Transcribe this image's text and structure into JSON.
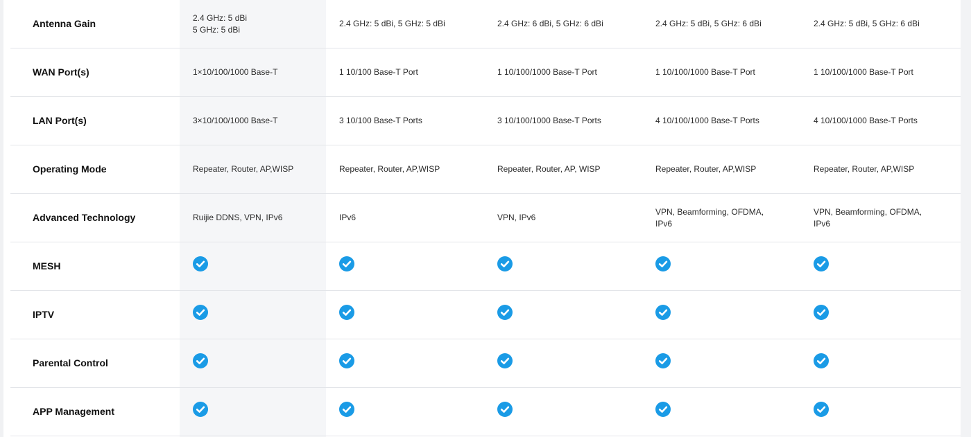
{
  "table": {
    "rows": [
      {
        "label": "Antenna Gain",
        "type": "text",
        "cells": [
          "2.4 GHz: 5 dBi\n5 GHz: 5 dBi",
          "2.4 GHz: 5 dBi, 5 GHz: 5 dBi",
          "2.4 GHz: 6 dBi, 5 GHz: 6 dBi",
          "2.4 GHz: 5 dBi, 5 GHz: 6 dBi",
          "2.4 GHz: 5 dBi, 5 GHz: 6 dBi"
        ]
      },
      {
        "label": "WAN Port(s)",
        "type": "text",
        "cells": [
          "1×10/100/1000 Base-T",
          "1 10/100 Base-T Port",
          "1 10/100/1000 Base-T Port",
          "1 10/100/1000 Base-T Port",
          "1 10/100/1000 Base-T Port"
        ]
      },
      {
        "label": "LAN Port(s)",
        "type": "text",
        "cells": [
          "3×10/100/1000 Base-T",
          "3 10/100 Base-T Ports",
          "3 10/100/1000 Base-T Ports",
          "4 10/100/1000 Base-T Ports",
          "4 10/100/1000 Base-T Ports"
        ]
      },
      {
        "label": "Operating Mode",
        "type": "text",
        "cells": [
          "Repeater, Router, AP,WISP",
          "Repeater, Router, AP,WISP",
          "Repeater, Router, AP, WISP",
          "Repeater, Router, AP,WISP",
          "Repeater, Router, AP,WISP"
        ]
      },
      {
        "label": "Advanced Technology",
        "type": "text",
        "cells": [
          "Ruijie DDNS, VPN, IPv6",
          "IPv6",
          "VPN, IPv6",
          "VPN, Beamforming, OFDMA,\nIPv6",
          "VPN, Beamforming, OFDMA,\nIPv6"
        ]
      },
      {
        "label": "MESH",
        "type": "check",
        "cells": [
          true,
          true,
          true,
          true,
          true
        ]
      },
      {
        "label": "IPTV",
        "type": "check",
        "cells": [
          true,
          true,
          true,
          true,
          true
        ]
      },
      {
        "label": "Parental Control",
        "type": "check",
        "cells": [
          true,
          true,
          true,
          true,
          true
        ]
      },
      {
        "label": "APP Management",
        "type": "check",
        "cells": [
          true,
          true,
          true,
          true,
          true
        ]
      }
    ]
  },
  "icons": {
    "check": "check-circle-icon"
  },
  "colors": {
    "check": "#1a9be6",
    "highlight_column": "#f5f6f8",
    "divider": "#e3e5e9"
  }
}
